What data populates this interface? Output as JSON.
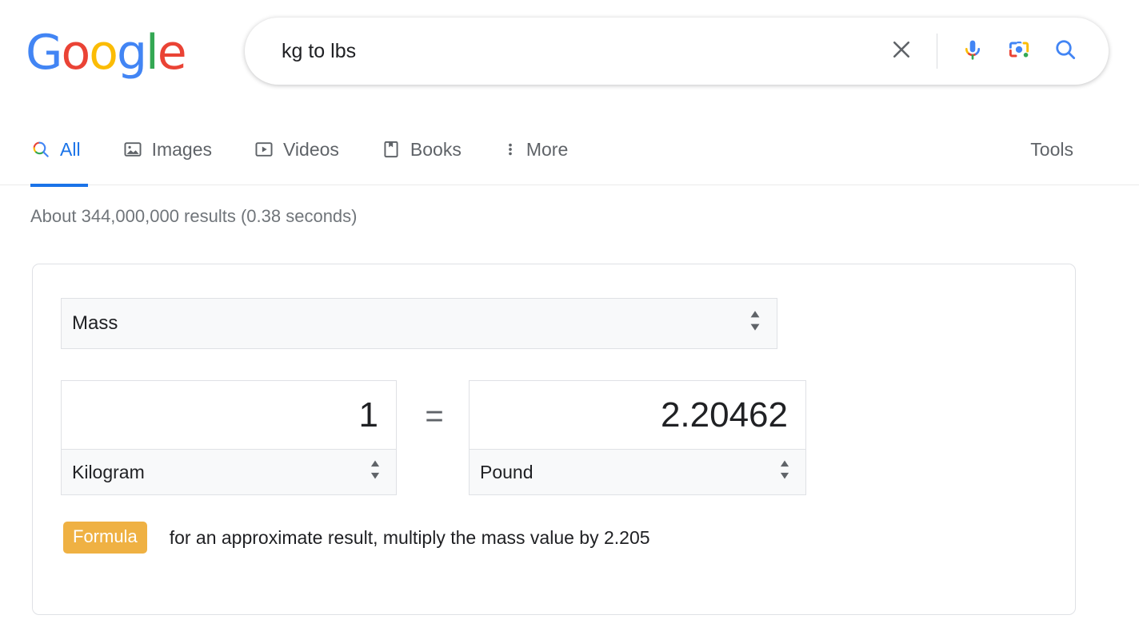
{
  "brand": {
    "name": "Google",
    "letters": [
      {
        "ch": "G",
        "color": "#4285F4"
      },
      {
        "ch": "o",
        "color": "#EA4335"
      },
      {
        "ch": "o",
        "color": "#FBBC05"
      },
      {
        "ch": "g",
        "color": "#4285F4"
      },
      {
        "ch": "l",
        "color": "#34A853"
      },
      {
        "ch": "e",
        "color": "#EA4335"
      }
    ]
  },
  "search": {
    "query": "kg to lbs",
    "placeholder": "Search",
    "clear_icon": "close-icon",
    "voice_icon": "microphone-icon",
    "lens_icon": "google-lens-icon",
    "submit_icon": "search-icon"
  },
  "tabs": [
    {
      "label": "All",
      "icon": "colored-search-icon",
      "active": true
    },
    {
      "label": "Images",
      "icon": "image-icon",
      "active": false
    },
    {
      "label": "Videos",
      "icon": "video-play-icon",
      "active": false
    },
    {
      "label": "Books",
      "icon": "book-icon",
      "active": false
    },
    {
      "label": "More",
      "icon": "more-vertical-icon",
      "active": false
    }
  ],
  "tools": {
    "label": "Tools"
  },
  "results": {
    "stats": "About 344,000,000 results (0.38 seconds)"
  },
  "converter": {
    "category": "Mass",
    "left": {
      "value": "1",
      "unit": "Kilogram"
    },
    "operator": "=",
    "right": {
      "value": "2.20462",
      "unit": "Pound"
    },
    "formula": {
      "badge": "Formula",
      "text": "for an approximate result, multiply the mass value by 2.205"
    }
  },
  "colors": {
    "accent_blue": "#1a73e8",
    "google_blue": "#4285F4",
    "google_red": "#EA4335",
    "google_yellow": "#FBBC05",
    "google_green": "#34A853",
    "formula_badge": "#efb143",
    "text_secondary": "#5f6368",
    "stats_gray": "#70757a"
  }
}
